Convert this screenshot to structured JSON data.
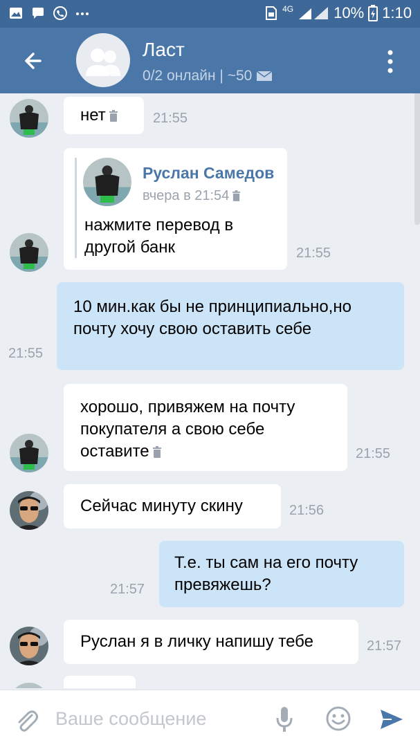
{
  "status_bar": {
    "network": "4G",
    "battery": "10%",
    "time": "1:10",
    "icons": [
      "image-icon",
      "chat-icon",
      "viber-icon",
      "more-dots-icon",
      "sim-icon",
      "signal-icon",
      "battery-icon"
    ]
  },
  "header": {
    "title": "Ласт",
    "subtitle": "0/2 онлайн | ~50",
    "accent": "#4a76a8"
  },
  "messages": [
    {
      "text": "нет",
      "time": "21:55",
      "direction": "in",
      "deleted": true
    },
    {
      "forward": {
        "author": "Руслан Самедов",
        "date": "вчера в 21:54",
        "text": "нажмите перевод в другой банк"
      },
      "time": "21:55",
      "direction": "in"
    },
    {
      "text": "10 мин.как бы не принципиально,но почту хочу свою оставить себе",
      "time": "21:55",
      "direction": "out"
    },
    {
      "text": "хорошо, привяжем на почту покупателя а свою себе оставите",
      "time": "21:55",
      "direction": "in",
      "deleted": true
    },
    {
      "text": "Сейчас минуту скину",
      "time": "21:56",
      "direction": "in"
    },
    {
      "text": "Т.е. ты сам на его почту превяжешь?",
      "time": "21:57",
      "direction": "out"
    },
    {
      "text": "Руслан я в личку напишу тебе",
      "time": "21:57",
      "direction": "in"
    }
  ],
  "input": {
    "placeholder": "Ваше сообщение"
  }
}
